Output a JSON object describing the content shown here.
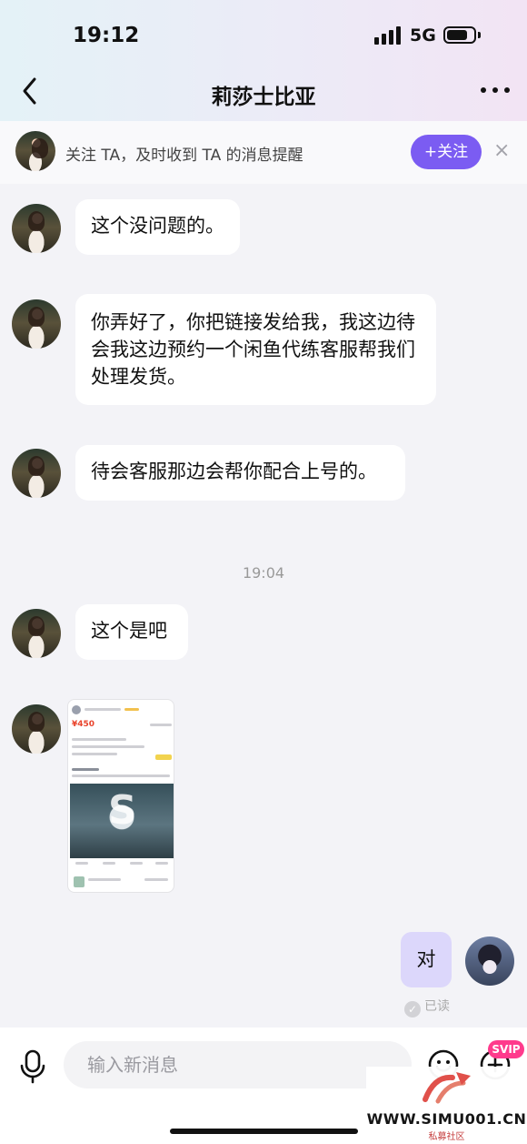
{
  "status_bar": {
    "time": "19:12",
    "network": "5G"
  },
  "header": {
    "title": "莉莎士比亚"
  },
  "follow_banner": {
    "text": "关注 TA，及时收到 TA 的消息提醒",
    "button_label": "+关注",
    "close_label": "×"
  },
  "messages": {
    "m1": "这个没问题的。",
    "m2": "你弄好了，你把链接发给我，我这边待会我这边预约一个闲鱼代练客服帮我们处理发货。",
    "m3": "待会客服那边会帮你配合上号的。",
    "timestamp": "19:04",
    "m4": "这个是吧",
    "photo_price": "¥450",
    "photo_letter": "S",
    "mine": "对",
    "read_status": "已读"
  },
  "input_bar": {
    "placeholder": "输入新消息",
    "svip_badge": "SVIP"
  },
  "watermark": {
    "url": "WWW.SIMU001.CN",
    "cn": "私募社区"
  },
  "colors": {
    "accent": "#7b5cf2",
    "my_bubble": "#dcd7fb",
    "svip": "#ff3a8c"
  }
}
